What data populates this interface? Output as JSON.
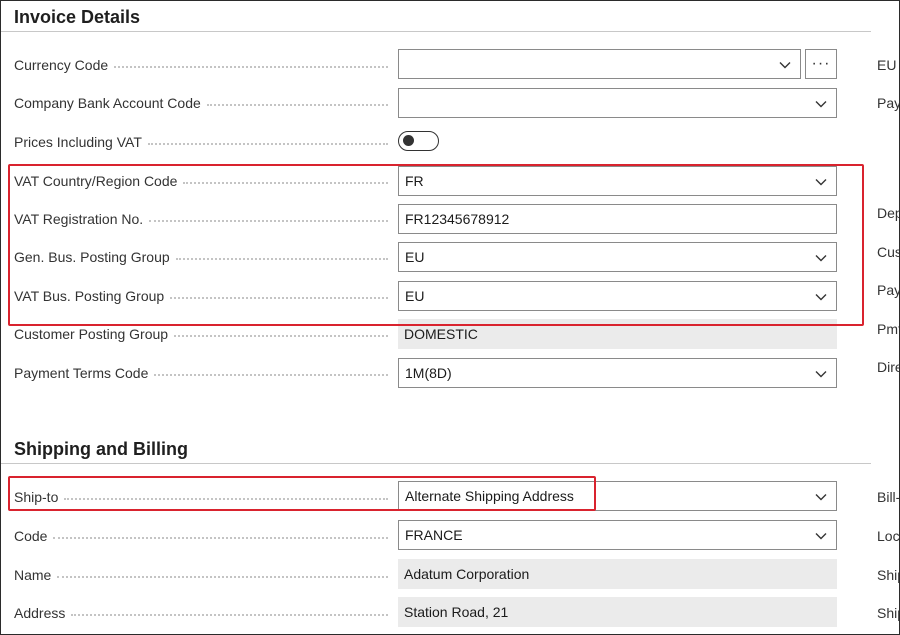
{
  "sections": {
    "invoice_details": "Invoice Details",
    "shipping_billing": "Shipping and Billing"
  },
  "invoice": {
    "currency_code": {
      "label": "Currency Code",
      "value": ""
    },
    "bank_account": {
      "label": "Company Bank Account Code",
      "value": ""
    },
    "prices_incl_vat": {
      "label": "Prices Including VAT",
      "value": "off"
    },
    "vat_country": {
      "label": "VAT Country/Region Code",
      "value": "FR"
    },
    "vat_reg_no": {
      "label": "VAT Registration No.",
      "value": "FR12345678912"
    },
    "gen_bus_posting": {
      "label": "Gen. Bus. Posting Group",
      "value": "EU"
    },
    "vat_bus_posting": {
      "label": "VAT Bus. Posting Group",
      "value": "EU"
    },
    "customer_posting": {
      "label": "Customer Posting Group",
      "value": "DOMESTIC"
    },
    "payment_terms": {
      "label": "Payment Terms Code",
      "value": "1M(8D)"
    },
    "ellipsis": "···"
  },
  "shipping": {
    "ship_to": {
      "label": "Ship-to",
      "value": "Alternate Shipping Address"
    },
    "code": {
      "label": "Code",
      "value": "FRANCE"
    },
    "name": {
      "label": "Name",
      "value": "Adatum Corporation"
    },
    "address": {
      "label": "Address",
      "value": "Station Road, 21"
    }
  },
  "right_column": {
    "r1": "EU",
    "r2": "Pay",
    "r3": "Dep",
    "r4": "Cus",
    "r5": "Pay",
    "r6": "Pmt",
    "r7": "Dire",
    "r8": "Bill-",
    "r9": "Loc",
    "r10": "Ship",
    "r11": "Ship"
  },
  "icons": {
    "dropdown": "chevron-down-icon",
    "lookup": "ellipsis-icon"
  },
  "colors": {
    "highlight": "#d9232e",
    "readonly_bg": "#ebebeb"
  }
}
